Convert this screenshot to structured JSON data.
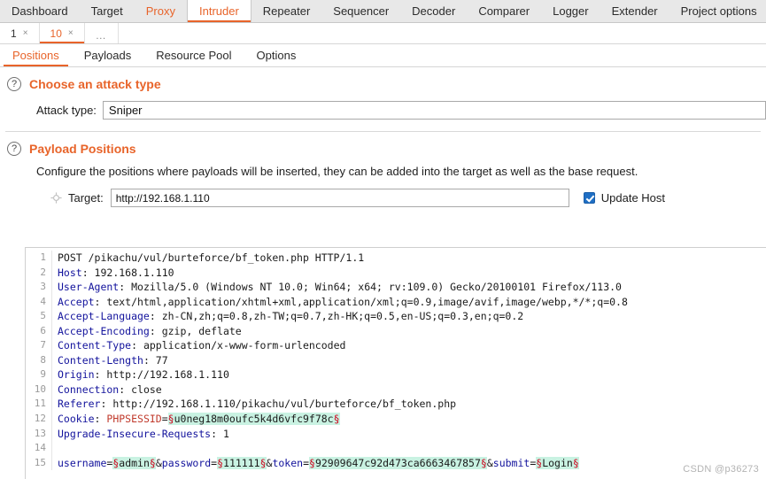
{
  "main_tabs": [
    {
      "label": "Dashboard",
      "state": "normal"
    },
    {
      "label": "Target",
      "state": "normal"
    },
    {
      "label": "Proxy",
      "state": "proxy"
    },
    {
      "label": "Intruder",
      "state": "active"
    },
    {
      "label": "Repeater",
      "state": "normal"
    },
    {
      "label": "Sequencer",
      "state": "normal"
    },
    {
      "label": "Decoder",
      "state": "normal"
    },
    {
      "label": "Comparer",
      "state": "normal"
    },
    {
      "label": "Logger",
      "state": "normal"
    },
    {
      "label": "Extender",
      "state": "normal"
    },
    {
      "label": "Project options",
      "state": "normal"
    }
  ],
  "attack_tabs": [
    {
      "label": "1",
      "close": "×",
      "active": false
    },
    {
      "label": "10",
      "close": "×",
      "active": true
    }
  ],
  "attack_tabs_more": "…",
  "inner_tabs": [
    {
      "label": "Positions",
      "active": true
    },
    {
      "label": "Payloads",
      "active": false
    },
    {
      "label": "Resource Pool",
      "active": false
    },
    {
      "label": "Options",
      "active": false
    }
  ],
  "attack_type_section": {
    "help_icon": "?",
    "title": "Choose an attack type",
    "label": "Attack type:",
    "value": "Sniper"
  },
  "payload_positions_section": {
    "help_icon": "?",
    "title": "Payload Positions",
    "description": "Configure the positions where payloads will be inserted, they can be added into the target as well as the base request."
  },
  "target": {
    "icon": "crosshair-icon",
    "label": "Target:",
    "value": "http://192.168.1.110",
    "update_host_label": "Update Host",
    "update_host_checked": true
  },
  "request": {
    "lines": [
      {
        "n": "1",
        "segments": [
          {
            "t": "POST /pikachu/vul/burteforce/bf_token.php HTTP/1.1",
            "c": "plain"
          }
        ]
      },
      {
        "n": "2",
        "segments": [
          {
            "t": "Host",
            "c": "hk"
          },
          {
            "t": ": 192.168.1.110",
            "c": "plain"
          }
        ]
      },
      {
        "n": "3",
        "segments": [
          {
            "t": "User-Agent",
            "c": "hk"
          },
          {
            "t": ": Mozilla/5.0 (Windows NT 10.0; Win64; x64; rv:109.0) Gecko/20100101 Firefox/113.0",
            "c": "plain"
          }
        ]
      },
      {
        "n": "4",
        "segments": [
          {
            "t": "Accept",
            "c": "hk"
          },
          {
            "t": ": text/html,application/xhtml+xml,application/xml;q=0.9,image/avif,image/webp,*/*;q=0.8",
            "c": "plain"
          }
        ]
      },
      {
        "n": "5",
        "segments": [
          {
            "t": "Accept-Language",
            "c": "hk"
          },
          {
            "t": ": zh-CN,zh;q=0.8,zh-TW;q=0.7,zh-HK;q=0.5,en-US;q=0.3,en;q=0.2",
            "c": "plain"
          }
        ]
      },
      {
        "n": "6",
        "segments": [
          {
            "t": "Accept-Encoding",
            "c": "hk"
          },
          {
            "t": ": gzip, deflate",
            "c": "plain"
          }
        ]
      },
      {
        "n": "7",
        "segments": [
          {
            "t": "Content-Type",
            "c": "hk"
          },
          {
            "t": ": application/x-www-form-urlencoded",
            "c": "plain"
          }
        ]
      },
      {
        "n": "8",
        "segments": [
          {
            "t": "Content-Length",
            "c": "hk"
          },
          {
            "t": ": 77",
            "c": "plain"
          }
        ]
      },
      {
        "n": "9",
        "segments": [
          {
            "t": "Origin",
            "c": "hk"
          },
          {
            "t": ": http://192.168.1.110",
            "c": "plain"
          }
        ]
      },
      {
        "n": "10",
        "segments": [
          {
            "t": "Connection",
            "c": "hk"
          },
          {
            "t": ": close",
            "c": "plain"
          }
        ]
      },
      {
        "n": "11",
        "segments": [
          {
            "t": "Referer",
            "c": "hk"
          },
          {
            "t": ": http://192.168.1.110/pikachu/vul/burteforce/bf_token.php",
            "c": "plain"
          }
        ]
      },
      {
        "n": "12",
        "segments": [
          {
            "t": "Cookie",
            "c": "hk"
          },
          {
            "t": ": ",
            "c": "plain"
          },
          {
            "t": "PHPSESSID",
            "c": "ck"
          },
          {
            "t": "=",
            "c": "plain"
          },
          {
            "t": "§",
            "c": "mark-hl"
          },
          {
            "t": "u0neg18m0oufc5k4d6vfc9f78c",
            "c": "hl"
          },
          {
            "t": "§",
            "c": "mark-hl"
          }
        ]
      },
      {
        "n": "13",
        "segments": [
          {
            "t": "Upgrade-Insecure-Requests",
            "c": "hk"
          },
          {
            "t": ": 1",
            "c": "plain"
          }
        ]
      },
      {
        "n": "14",
        "segments": [
          {
            "t": "",
            "c": "plain"
          }
        ]
      },
      {
        "n": "15",
        "segments": [
          {
            "t": "username",
            "c": "pk"
          },
          {
            "t": "=",
            "c": "plain"
          },
          {
            "t": "§",
            "c": "mark-hl"
          },
          {
            "t": "admin",
            "c": "hl"
          },
          {
            "t": "§",
            "c": "mark-hl"
          },
          {
            "t": "&",
            "c": "plain"
          },
          {
            "t": "password",
            "c": "pk"
          },
          {
            "t": "=",
            "c": "plain"
          },
          {
            "t": "§",
            "c": "mark-hl"
          },
          {
            "t": "111111",
            "c": "hl"
          },
          {
            "t": "§",
            "c": "mark-hl"
          },
          {
            "t": "&",
            "c": "plain"
          },
          {
            "t": "token",
            "c": "pk"
          },
          {
            "t": "=",
            "c": "plain"
          },
          {
            "t": "§",
            "c": "mark-hl"
          },
          {
            "t": "92909647c92d473ca6663467857",
            "c": "hl"
          },
          {
            "t": "§",
            "c": "mark-hl"
          },
          {
            "t": "&",
            "c": "plain"
          },
          {
            "t": "submit",
            "c": "pk"
          },
          {
            "t": "=",
            "c": "plain"
          },
          {
            "t": "§",
            "c": "mark-hl"
          },
          {
            "t": "Login",
            "c": "hl"
          },
          {
            "t": "§",
            "c": "mark-hl"
          }
        ]
      }
    ]
  },
  "watermark": "CSDN @p36273",
  "colors": {
    "accent": "#e8642a",
    "header_key": "#12129c",
    "cookie_key": "#c0392b",
    "marker": "#d0021b",
    "highlight": "#c9f2e2",
    "checkbox": "#1f6fc4"
  }
}
